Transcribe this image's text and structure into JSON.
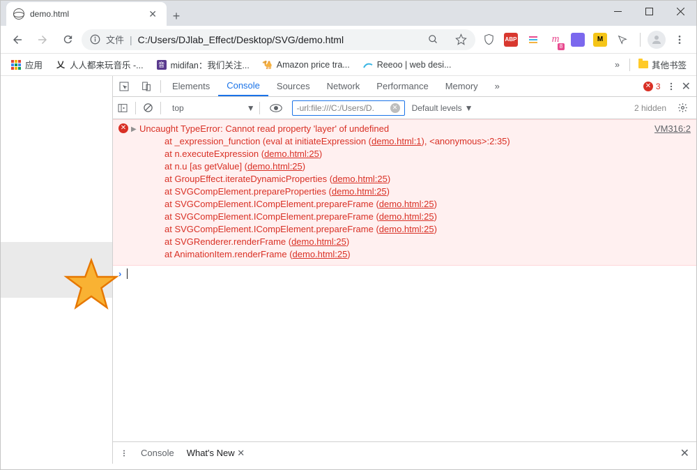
{
  "window": {
    "tab_title": "demo.html",
    "url_prefix": "文件",
    "url": "C:/Users/DJlab_Effect/Desktop/SVG/demo.html"
  },
  "bookmarks": {
    "apps_label": "应用",
    "items": [
      "人人都来玩音乐 -...",
      "midifan：我们关注...",
      "Amazon price tra...",
      "Reeoo | web desi..."
    ],
    "overflow": "»",
    "other": "其他书签"
  },
  "devtools": {
    "tabs": [
      "Elements",
      "Console",
      "Sources",
      "Network",
      "Performance",
      "Memory"
    ],
    "active_tab": "Console",
    "more": "»",
    "error_count": "3",
    "context": "top",
    "filter_value": "-url:file:///C:/Users/D.",
    "levels": "Default levels",
    "hidden": "2 hidden",
    "error": {
      "source": "VM316:2",
      "message": "Uncaught TypeError: Cannot read property 'layer' of undefined",
      "stack": [
        {
          "pre": "at _expression_function (eval at initiateExpression (",
          "link": "demo.html:1",
          "post": "), <anonymous>:2:35)"
        },
        {
          "pre": "at n.executeExpression (",
          "link": "demo.html:25",
          "post": ")"
        },
        {
          "pre": "at n.u [as getValue] (",
          "link": "demo.html:25",
          "post": ")"
        },
        {
          "pre": "at GroupEffect.iterateDynamicProperties (",
          "link": "demo.html:25",
          "post": ")"
        },
        {
          "pre": "at SVGCompElement.prepareProperties (",
          "link": "demo.html:25",
          "post": ")"
        },
        {
          "pre": "at SVGCompElement.ICompElement.prepareFrame (",
          "link": "demo.html:25",
          "post": ")"
        },
        {
          "pre": "at SVGCompElement.ICompElement.prepareFrame (",
          "link": "demo.html:25",
          "post": ")"
        },
        {
          "pre": "at SVGCompElement.ICompElement.prepareFrame (",
          "link": "demo.html:25",
          "post": ")"
        },
        {
          "pre": "at SVGRenderer.renderFrame (",
          "link": "demo.html:25",
          "post": ")"
        },
        {
          "pre": "at AnimationItem.renderFrame (",
          "link": "demo.html:25",
          "post": ")"
        }
      ]
    },
    "drawer": {
      "tabs": [
        "Console",
        "What's New"
      ],
      "active": "What's New"
    }
  }
}
